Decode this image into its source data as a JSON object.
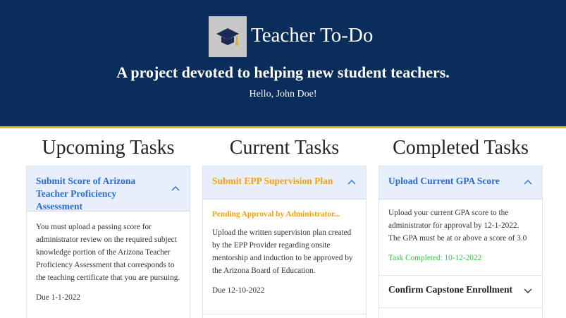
{
  "header": {
    "app_title": "Teacher To-Do",
    "logo_icon": "graduation-cap-icon",
    "tagline": "A project devoted to helping new student teachers.",
    "greeting": "Hello, John Doe!",
    "background_color": "#0b2d5c",
    "accent_color": "#e3b21d"
  },
  "columns": {
    "upcoming": {
      "title": "Upcoming Tasks",
      "task": {
        "title": "Submit Score of Arizona Teacher Proficiency Assessment",
        "description": "You must upload a passing score for administrator review on the required subject knowledge portion of the Arizona Teacher Proficiency Assessment that corresponds to the teaching certificate that you are pursuing.",
        "due": "Due 1-1-2022",
        "toggle_icon": "chevron-up-icon"
      }
    },
    "current": {
      "title": "Current Tasks",
      "task": {
        "title": "Submit EPP Supervision Plan",
        "status": "Pending Approval by Administrator...",
        "description": "Upload the written supervision plan created by the EPP Provider regarding onsite mentorship and induction to be approved by the Arizona Board of Education.",
        "due": "Due 12-10-2022",
        "toggle_icon": "chevron-up-icon"
      }
    },
    "completed": {
      "title": "Completed Tasks",
      "task": {
        "title": "Upload Current GPA Score",
        "description": "Upload your current GPA score to the administrator for approval by 12-1-2022. The GPA must be at or above a score of 3.0",
        "status": "Task Completed: 10-12-2022",
        "toggle_icon": "chevron-up-icon"
      },
      "collapsed_task": {
        "title": "Confirm Capstone Enrollment",
        "toggle_icon": "chevron-down-icon"
      }
    }
  },
  "colors": {
    "task_header_bg": "#e6effb",
    "task_title_blue": "#2d6ccb",
    "pending_orange": "#f0a21e",
    "completed_green": "#3cc24f"
  }
}
